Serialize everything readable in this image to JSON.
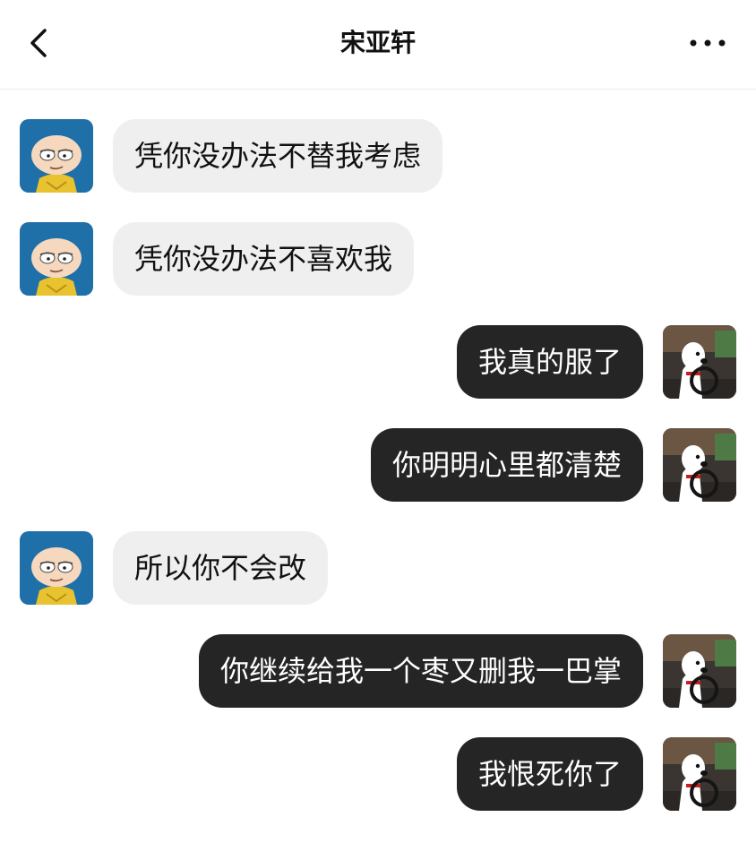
{
  "header": {
    "title": "宋亚轩",
    "back_icon": "chevron-left-icon",
    "more_icon": "more-horizontal-icon"
  },
  "colors": {
    "incoming_bubble": "#efefef",
    "outgoing_bubble": "#252525",
    "incoming_avatar_bg": "#1f6fa8",
    "outgoing_avatar_bg": "#3a3530"
  },
  "messages": [
    {
      "direction": "incoming",
      "text": "凭你没办法不替我考虑"
    },
    {
      "direction": "incoming",
      "text": "凭你没办法不喜欢我"
    },
    {
      "direction": "outgoing",
      "text": "我真的服了"
    },
    {
      "direction": "outgoing",
      "text": "你明明心里都清楚"
    },
    {
      "direction": "incoming",
      "text": "所以你不会改"
    },
    {
      "direction": "outgoing",
      "text": "你继续给我一个枣又删我一巴掌"
    },
    {
      "direction": "outgoing",
      "text": "我恨死你了"
    }
  ]
}
